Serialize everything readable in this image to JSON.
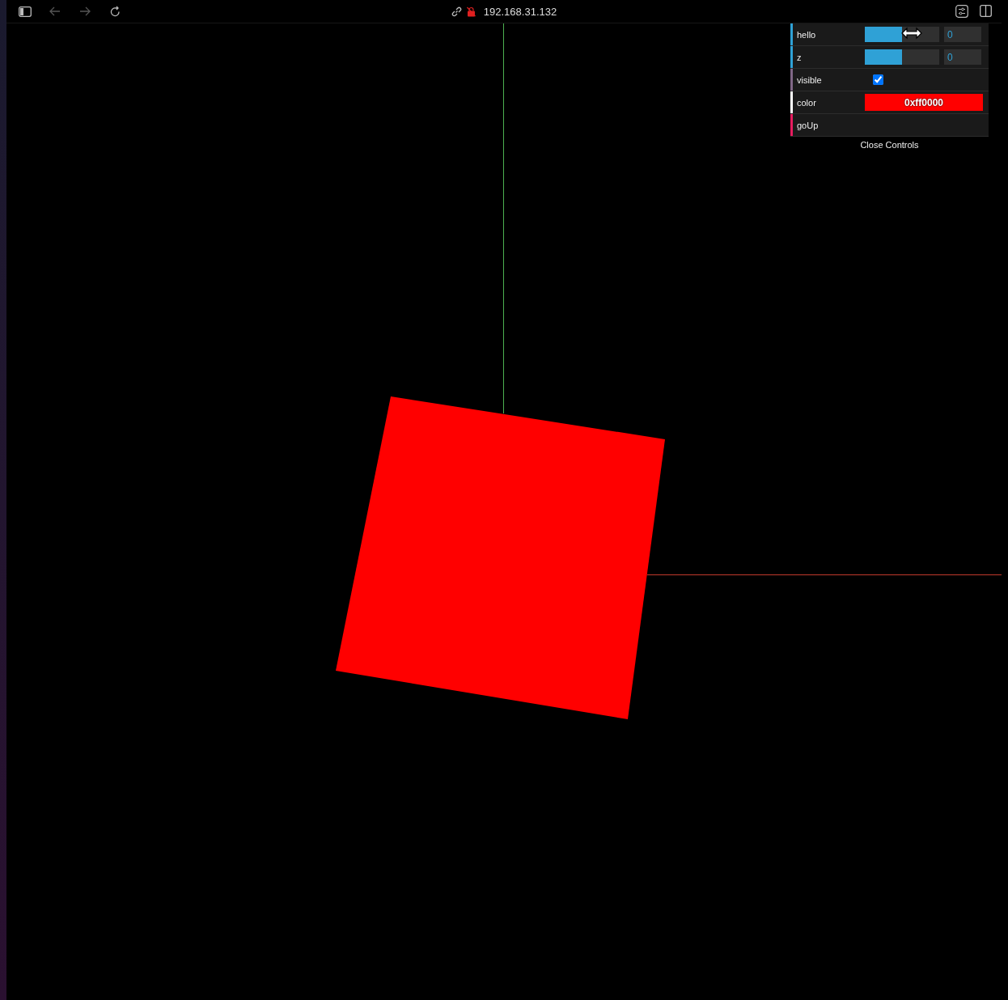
{
  "browser": {
    "url": "192.168.31.132",
    "back_disabled": true,
    "forward_disabled": true
  },
  "controls": {
    "rows": [
      {
        "kind": "slider",
        "label": "hello",
        "level": 0.5,
        "value": "0",
        "color": "#2fa1d6"
      },
      {
        "kind": "slider",
        "label": "z",
        "level": 0.5,
        "value": "0",
        "color": "#2fa1d6"
      },
      {
        "kind": "checkbox",
        "label": "visible",
        "checked": true,
        "color": "#806787"
      },
      {
        "kind": "color",
        "label": "color",
        "value": "0xff0000",
        "color": "#ffffff"
      },
      {
        "kind": "function",
        "label": "goUp",
        "color": "#e61d5f"
      }
    ],
    "close_label": "Close Controls"
  }
}
